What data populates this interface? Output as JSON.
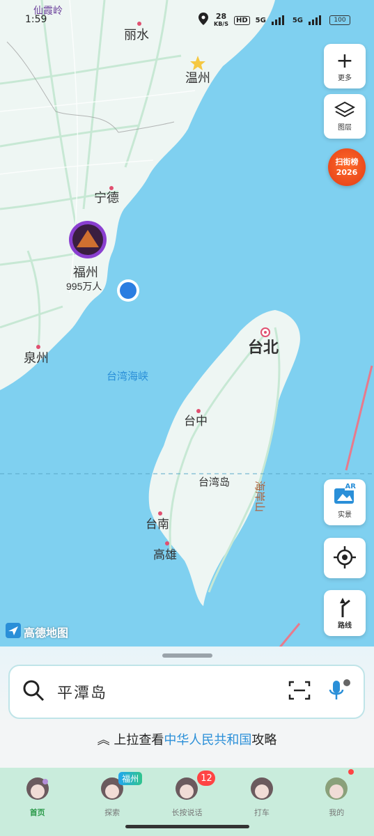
{
  "status_bar": {
    "time": "1:59",
    "net_speed": "28",
    "net_unit": "KB/S",
    "hd": "HD",
    "sim1": "5G",
    "sim2": "5G",
    "battery": "100"
  },
  "map": {
    "city_labels": [
      "丽水",
      "温州",
      "宁德",
      "泉州",
      "台北",
      "台中",
      "台湾岛",
      "台南",
      "高雄"
    ],
    "poi": {
      "name": "福州",
      "population": "995万人"
    },
    "strait_label": "台湾海峡",
    "mountain_label": "海岸山",
    "watermark": "高德地图",
    "top_fragment": "仙霞岭"
  },
  "controls": {
    "more_label": "更多",
    "layers_label": "图层",
    "rank_line1": "扫街榜",
    "rank_line2": "2026",
    "ar_label": "实景",
    "ar_badge": "AR",
    "route_label": "路线"
  },
  "search": {
    "value": "平潭岛"
  },
  "hint": {
    "prefix": "上拉查看",
    "highlight": "中华人民共和国",
    "suffix": "攻略"
  },
  "tabs": [
    {
      "label": "首页",
      "tag": ""
    },
    {
      "label": "探索",
      "tag": "福州"
    },
    {
      "label": "长按说话",
      "tag": "12"
    },
    {
      "label": "打车",
      "tag": ""
    },
    {
      "label": "我的",
      "tag": ""
    }
  ],
  "colors": {
    "sea": "#7fd0f0",
    "land": "#eef6f3",
    "accent": "#2a8fd8",
    "tabbar": "#c9ecdc",
    "location_dot": "#2a7de1"
  }
}
